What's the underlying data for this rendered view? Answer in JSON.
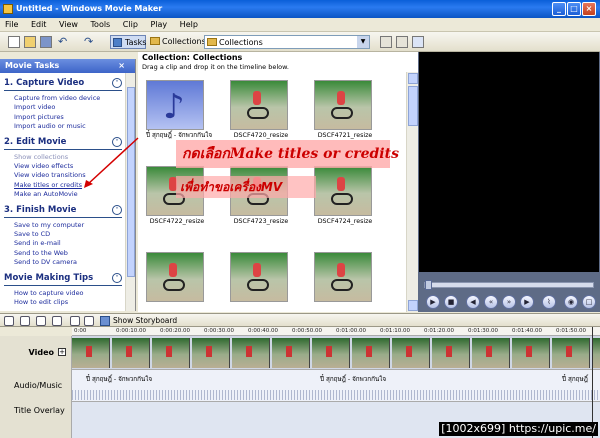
{
  "window": {
    "title": "Untitled - Windows Movie Maker"
  },
  "menu": [
    "File",
    "Edit",
    "View",
    "Tools",
    "Clip",
    "Play",
    "Help"
  ],
  "toolbar": {
    "tasks": "Tasks",
    "collections": "Collections",
    "collection_dropdown": "Collections"
  },
  "task_pane": {
    "header": "Movie Tasks",
    "close": "×",
    "sections": [
      {
        "title": "1. Capture Video",
        "links": [
          "Capture from video device",
          "Import video",
          "Import pictures",
          "Import audio or music"
        ]
      },
      {
        "title": "2. Edit Movie",
        "links": [
          "Show collections",
          "View video effects",
          "View video transitions",
          "Make titles or credits",
          "Make an AutoMovie"
        ]
      },
      {
        "title": "3. Finish Movie",
        "links": [
          "Save to my computer",
          "Save to CD",
          "Send in e-mail",
          "Send to the Web",
          "Send to DV camera"
        ]
      },
      {
        "title": "Movie Making Tips",
        "links": [
          "How to capture video",
          "How to edit clips"
        ]
      }
    ]
  },
  "collection": {
    "title": "Collection: Collections",
    "hint": "Drag a clip and drop it on the timeline below.",
    "items": [
      {
        "label": "ปี๋ สุกฤษฎิ์ - จักพวกกันใจ",
        "type": "audio"
      },
      {
        "label": "DSCF4720_resize",
        "type": "video"
      },
      {
        "label": "DSCF4721_resize",
        "type": "video"
      },
      {
        "label": "DSCF4722_resize",
        "type": "video"
      },
      {
        "label": "DSCF4723_resize",
        "type": "video"
      },
      {
        "label": "DSCF4724_resize",
        "type": "video"
      },
      {
        "label": "",
        "type": "video"
      },
      {
        "label": "",
        "type": "video"
      },
      {
        "label": "",
        "type": "video"
      }
    ]
  },
  "annotation": {
    "line1": "กดเลือกMake titles or credits",
    "line2": "เพื่อทำขอเครื่องMV"
  },
  "storyboard": {
    "label": "Show Storyboard"
  },
  "timeline": {
    "ruler": [
      "0:00",
      "0:00:10.00",
      "0:00:20.00",
      "0:00:30.00",
      "0:00:40.00",
      "0:00:50.00",
      "0:01:00.00",
      "0:01:10.00",
      "0:01:20.00",
      "0:01:30.00",
      "0:01:40.00",
      "0:01:50.00"
    ],
    "tracks": {
      "video": "Video",
      "audio": "Audio/Music",
      "title_overlay": "Title Overlay"
    },
    "audio_clips": [
      "ปี๋ สุกฤษฎิ์ - จักพวกกันใจ",
      "ปี๋ สุกฤษฎิ์ - จักพวกกันใจ",
      "ปี๋ สุกฤษฎิ์"
    ]
  },
  "watermark": "[1002x699] https://upic.me/"
}
